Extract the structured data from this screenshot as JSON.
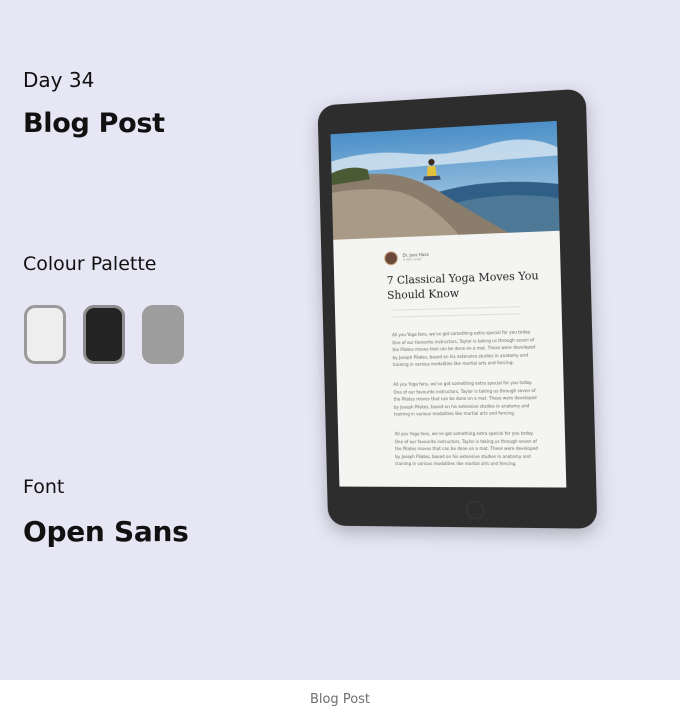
{
  "day": "Day 34",
  "title": "Blog Post",
  "palette": {
    "heading": "Colour Palette",
    "colors": [
      "#eeeeee",
      "#232323",
      "#9d9d9d"
    ]
  },
  "font": {
    "label": "Font",
    "name": "Open Sans"
  },
  "tablet": {
    "author_name": "Dr. Jane Hasa",
    "author_meta": "5 min read",
    "post_title": "7 Classical Yoga Moves You Should Know",
    "paragraphs": [
      "All you Yoga fans, we've got something extra special for you today. One of our favourite instructors, Taylor is taking us through seven of the Pilates moves that can be done on a mat. These were developed by Joseph Pilates, based on his extensive studies in anatomy and training in various modalities like martial arts and fencing.",
      "All you Yoga fans, we've got something extra special for you today. One of our favourite instructors, Taylor is taking us through seven of the Pilates moves that can be done on a mat. These were developed by Joseph Pilates, based on his extensive studies in anatomy and training in various modalities like martial arts and fencing.",
      "All you Yoga fans, we've got something extra special for you today. One of our favourite instructors, Taylor is taking us through seven of the Pilates moves that can be done on a mat. These were developed by Joseph Pilates, based on his extensive studies in anatomy and training in various modalities like martial arts and fencing."
    ]
  },
  "footer": "Blog Post"
}
